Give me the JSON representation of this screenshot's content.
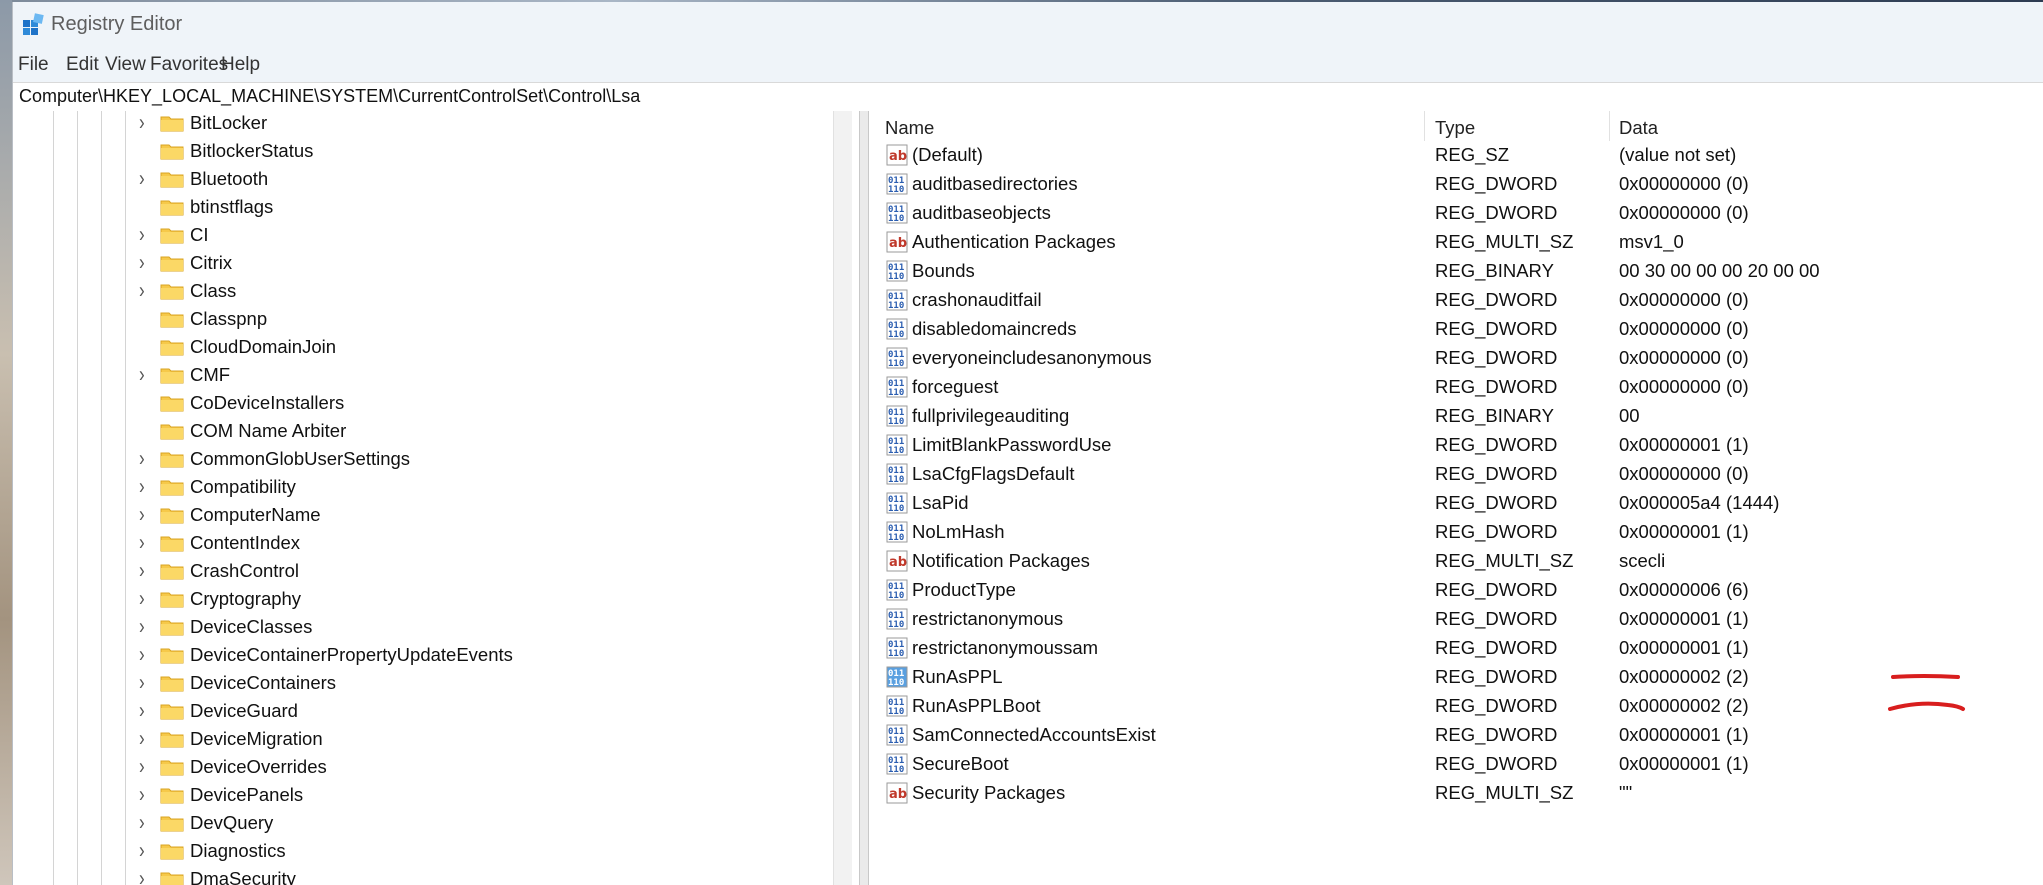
{
  "window": {
    "title": "Registry Editor"
  },
  "menu": [
    "File",
    "Edit",
    "View",
    "Favorites",
    "Help"
  ],
  "address": "Computer\\HKEY_LOCAL_MACHINE\\SYSTEM\\CurrentControlSet\\Control\\Lsa",
  "tree": {
    "items": [
      {
        "label": "BitLocker",
        "expandable": true
      },
      {
        "label": "BitlockerStatus",
        "expandable": false
      },
      {
        "label": "Bluetooth",
        "expandable": true
      },
      {
        "label": "btinstflags",
        "expandable": false
      },
      {
        "label": "CI",
        "expandable": true
      },
      {
        "label": "Citrix",
        "expandable": true
      },
      {
        "label": "Class",
        "expandable": true
      },
      {
        "label": "Classpnp",
        "expandable": false
      },
      {
        "label": "CloudDomainJoin",
        "expandable": false
      },
      {
        "label": "CMF",
        "expandable": true
      },
      {
        "label": "CoDeviceInstallers",
        "expandable": false
      },
      {
        "label": "COM Name Arbiter",
        "expandable": false
      },
      {
        "label": "CommonGlobUserSettings",
        "expandable": true
      },
      {
        "label": "Compatibility",
        "expandable": true
      },
      {
        "label": "ComputerName",
        "expandable": true
      },
      {
        "label": "ContentIndex",
        "expandable": true
      },
      {
        "label": "CrashControl",
        "expandable": true
      },
      {
        "label": "Cryptography",
        "expandable": true
      },
      {
        "label": "DeviceClasses",
        "expandable": true
      },
      {
        "label": "DeviceContainerPropertyUpdateEvents",
        "expandable": true
      },
      {
        "label": "DeviceContainers",
        "expandable": true
      },
      {
        "label": "DeviceGuard",
        "expandable": true
      },
      {
        "label": "DeviceMigration",
        "expandable": true
      },
      {
        "label": "DeviceOverrides",
        "expandable": true
      },
      {
        "label": "DevicePanels",
        "expandable": true
      },
      {
        "label": "DevQuery",
        "expandable": true
      },
      {
        "label": "Diagnostics",
        "expandable": true
      },
      {
        "label": "DmaSecurity",
        "expandable": true
      }
    ]
  },
  "values": {
    "columns": {
      "name": "Name",
      "type": "Type",
      "data": "Data"
    },
    "rows": [
      {
        "icon": "string-value-icon",
        "name": "(Default)",
        "type": "REG_SZ",
        "data": "(value not set)"
      },
      {
        "icon": "binary-value-icon",
        "name": "auditbasedirectories",
        "type": "REG_DWORD",
        "data": "0x00000000 (0)"
      },
      {
        "icon": "binary-value-icon",
        "name": "auditbaseobjects",
        "type": "REG_DWORD",
        "data": "0x00000000 (0)"
      },
      {
        "icon": "string-value-icon",
        "name": "Authentication Packages",
        "type": "REG_MULTI_SZ",
        "data": "msv1_0"
      },
      {
        "icon": "binary-value-icon",
        "name": "Bounds",
        "type": "REG_BINARY",
        "data": "00 30 00 00 00 20 00 00"
      },
      {
        "icon": "binary-value-icon",
        "name": "crashonauditfail",
        "type": "REG_DWORD",
        "data": "0x00000000 (0)"
      },
      {
        "icon": "binary-value-icon",
        "name": "disabledomaincreds",
        "type": "REG_DWORD",
        "data": "0x00000000 (0)"
      },
      {
        "icon": "binary-value-icon",
        "name": "everyoneincludesanonymous",
        "type": "REG_DWORD",
        "data": "0x00000000 (0)"
      },
      {
        "icon": "binary-value-icon",
        "name": "forceguest",
        "type": "REG_DWORD",
        "data": "0x00000000 (0)"
      },
      {
        "icon": "binary-value-icon",
        "name": "fullprivilegeauditing",
        "type": "REG_BINARY",
        "data": "00"
      },
      {
        "icon": "binary-value-icon",
        "name": "LimitBlankPasswordUse",
        "type": "REG_DWORD",
        "data": "0x00000001 (1)"
      },
      {
        "icon": "binary-value-icon",
        "name": "LsaCfgFlagsDefault",
        "type": "REG_DWORD",
        "data": "0x00000000 (0)"
      },
      {
        "icon": "binary-value-icon",
        "name": "LsaPid",
        "type": "REG_DWORD",
        "data": "0x000005a4 (1444)"
      },
      {
        "icon": "binary-value-icon",
        "name": "NoLmHash",
        "type": "REG_DWORD",
        "data": "0x00000001 (1)"
      },
      {
        "icon": "string-value-icon",
        "name": "Notification Packages",
        "type": "REG_MULTI_SZ",
        "data": "scecli"
      },
      {
        "icon": "binary-value-icon",
        "name": "ProductType",
        "type": "REG_DWORD",
        "data": "0x00000006 (6)"
      },
      {
        "icon": "binary-value-icon",
        "name": "restrictanonymous",
        "type": "REG_DWORD",
        "data": "0x00000001 (1)"
      },
      {
        "icon": "binary-value-icon",
        "name": "restrictanonymoussam",
        "type": "REG_DWORD",
        "data": "0x00000001 (1)"
      },
      {
        "icon": "binary-value-icon",
        "name": "RunAsPPL",
        "type": "REG_DWORD",
        "data": "0x00000002 (2)",
        "selected": true
      },
      {
        "icon": "binary-value-icon",
        "name": "RunAsPPLBoot",
        "type": "REG_DWORD",
        "data": "0x00000002 (2)"
      },
      {
        "icon": "binary-value-icon",
        "name": "SamConnectedAccountsExist",
        "type": "REG_DWORD",
        "data": "0x00000001 (1)"
      },
      {
        "icon": "binary-value-icon",
        "name": "SecureBoot",
        "type": "REG_DWORD",
        "data": "0x00000001 (1)"
      },
      {
        "icon": "string-value-icon",
        "name": "Security Packages",
        "type": "REG_MULTI_SZ",
        "data": "\"\""
      }
    ]
  },
  "colors": {
    "folder": "#f6c94a",
    "annotation": "#d81e1e",
    "selected_icon": "#5aa0e0"
  }
}
